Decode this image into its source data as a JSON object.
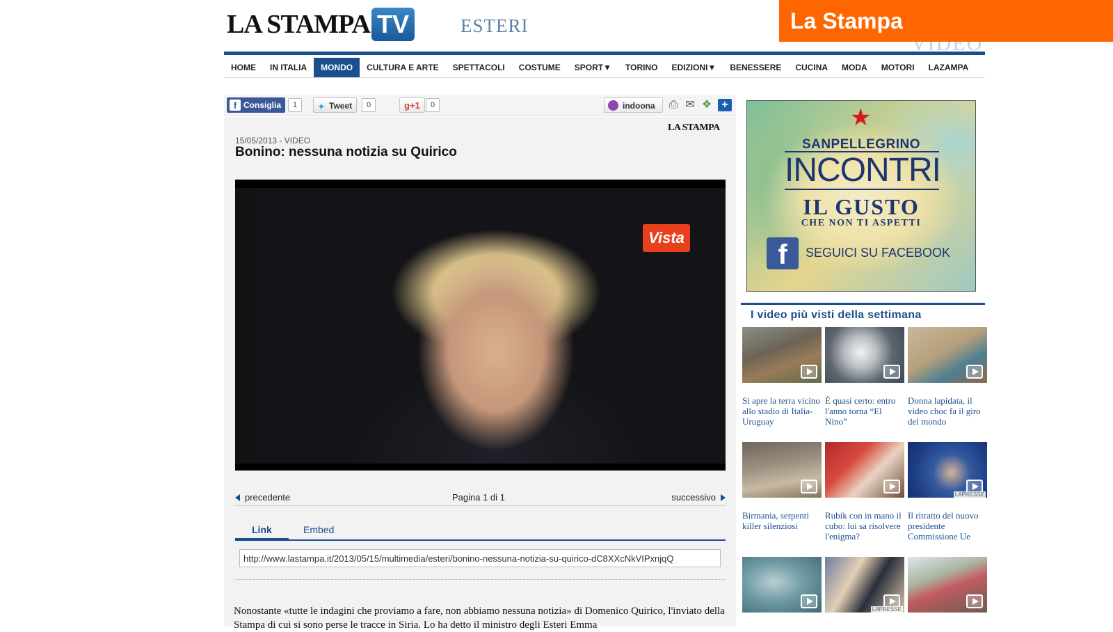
{
  "header": {
    "logo_main": "LA STAMPA",
    "logo_tv": "TV",
    "section": "ESTERI",
    "brand_banner": "La Stampa",
    "video_ghost": "VIDEO"
  },
  "nav": {
    "items": [
      "HOME",
      "IN ITALIA",
      "MONDO",
      "CULTURA E ARTE",
      "SPETTACOLI",
      "COSTUME",
      "SPORT▼",
      "TORINO",
      "EDIZIONI▼",
      "BENESSERE",
      "CUCINA",
      "MODA",
      "MOTORI",
      "LAZAMPA"
    ],
    "active": "MONDO"
  },
  "social": {
    "fb_label": "Consiglia",
    "fb_count": "1",
    "tweet_label": "Tweet",
    "tweet_count": "0",
    "gplus_label": "g+1",
    "gplus_count": "0",
    "indoona_label": "indoona"
  },
  "article": {
    "source_mark": "LA STAMPA",
    "date": "15/05/2013 - VIDEO",
    "title": "Bonino: nessuna notizia su Quirico",
    "video_watermark": "Vista",
    "body": "Nonostante «tutte le indagini che proviamo a fare, non abbiamo nessuna notizia» di Domenico Quirico, l'inviato della Stampa di cui si sono perse le tracce in Siria. Lo ha detto il ministro degli Esteri Emma"
  },
  "pager": {
    "prev": "precedente",
    "page": "Pagina 1 di 1",
    "next": "successivo"
  },
  "share_tabs": {
    "link": "Link",
    "embed": "Embed",
    "link_value": "http://www.lastampa.it/2013/05/15/multimedia/esteri/bonino-nessuna-notizia-su-quirico-dC8XXcNkVIPxnjqQ"
  },
  "ad": {
    "brand": "SANPELLEGRINO",
    "headline": "INCONTRI",
    "line2": "IL GUSTO",
    "line3": "CHE NON TI ASPETTI",
    "cta": "SEGUICI SU FACEBOOK"
  },
  "sidebar": {
    "most_viewed_title": "I video più visti della settimana",
    "videos": [
      {
        "caption": "Si apre la terra vicino allo stadio di Italia-Uruguay",
        "credit": ""
      },
      {
        "caption": "È quasi certo: entro l'anno torna “El Nino”",
        "credit": ""
      },
      {
        "caption": "Donna lapidata, il video choc fa il giro del mondo",
        "credit": ""
      },
      {
        "caption": "Birmania, serpenti killer silenziosi",
        "credit": ""
      },
      {
        "caption": "Rubik con in mano il cubo: lui sa risolvere l'enigma?",
        "credit": ""
      },
      {
        "caption": "Il ritratto del nuovo presidente Commissione Ue",
        "credit": "LAPRESSE"
      },
      {
        "caption": "",
        "credit": ""
      },
      {
        "caption": "",
        "credit": "LAPRESSE"
      },
      {
        "caption": "",
        "credit": ""
      }
    ]
  },
  "colors": {
    "brand_blue": "#1a4f8e",
    "banner_orange": "#ff6600"
  }
}
